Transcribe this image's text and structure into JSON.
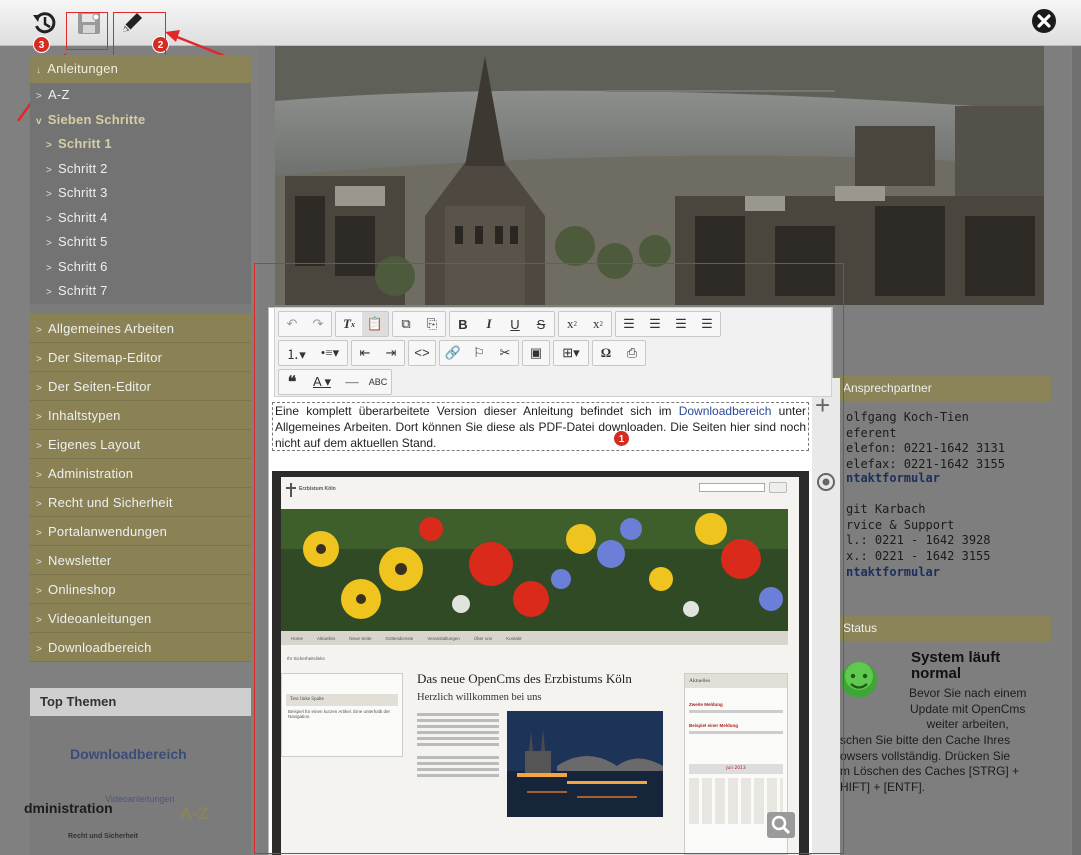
{
  "toolbar": {
    "icons": [
      "history-icon",
      "save-icon",
      "edit-pencil-icon",
      "close-icon"
    ],
    "badges": {
      "history": "3",
      "edit": "2",
      "note": "1"
    }
  },
  "nav": {
    "anleitungen": "Anleitungen",
    "az": "A-Z",
    "sieben": "Sieben Schritte",
    "steps": [
      "Schritt 1",
      "Schritt 2",
      "Schritt 3",
      "Schritt 4",
      "Schritt 5",
      "Schritt 6",
      "Schritt 7"
    ],
    "groups": [
      "Allgemeines Arbeiten",
      "Der Sitemap-Editor",
      "Der Seiten-Editor",
      "Inhaltstypen",
      "Eigenes Layout",
      "Administration",
      "Recht und Sicherheit",
      "Portalanwendungen",
      "Newsletter",
      "Onlineshop",
      "Videoanleitungen",
      "Downloadbereich"
    ]
  },
  "top_themen": {
    "title": "Top Themen",
    "cloud": {
      "downloadbereich": "Downloadbereich",
      "administration": "dministration",
      "videoanleitungen": "Videoanleitungen",
      "az": "A-Z",
      "recht": "Recht und Sicherheit"
    }
  },
  "editor": {
    "note_part1": "Eine komplett überarbeitete Version dieser Anleitung befindet sich im ",
    "note_link": "Downloadbereich",
    "note_part2": " unter Allgemeines Arbeiten. Dort können Sie diese als PDF-Datei downloaden. Die Seiten hier sind noch nicht auf dem aktuellen Stand."
  },
  "shot": {
    "logo": "Erzbistum Köln",
    "nav": [
      "Home",
      "Aktuelles",
      "Neue Seite",
      "Gottesdienste",
      "Veranstaltungen",
      "Über uns",
      "Kontakt"
    ],
    "breadcrumb": "Ihr Sicherheitslinks",
    "left_title": "Text linke Spalte",
    "left_text": "Beispiel für einen kurzen Artikel. Eine unterhalb der Navigation.",
    "main_title": "Das neue OpenCms des Erzbistums Köln",
    "main_sub": "Herzlich willkommen bei uns",
    "right_title": "Aktuelles",
    "event1": "Zweite Meldung",
    "event2": "Beispiel einer Meldung",
    "cal": "Juli 2013"
  },
  "right": {
    "ansprech": "Ansprechpartner",
    "contact1": "olfgang Koch-Tien\neferent\nelefon: 0221-1642 3131\nelefax: 0221-1642 3155",
    "link1": "ntaktformular",
    "contact2": "git Karbach\nrvice & Support\nl.: 0221 - 1642 3928\nx.: 0221 - 1642 3155",
    "link2": "ntaktformular",
    "status": "Status",
    "sys_title": "System läuft\nnormal",
    "sys_text1": "Bevor Sie nach einem\nUpdate mit OpenCms\nweiter arbeiten,",
    "sys_text2": "schen Sie bitte den Cache Ihres\nowsers vollständig. Drücken Sie\nm Löschen des Caches [STRG] +\nHIFT] + [ENTF]."
  }
}
